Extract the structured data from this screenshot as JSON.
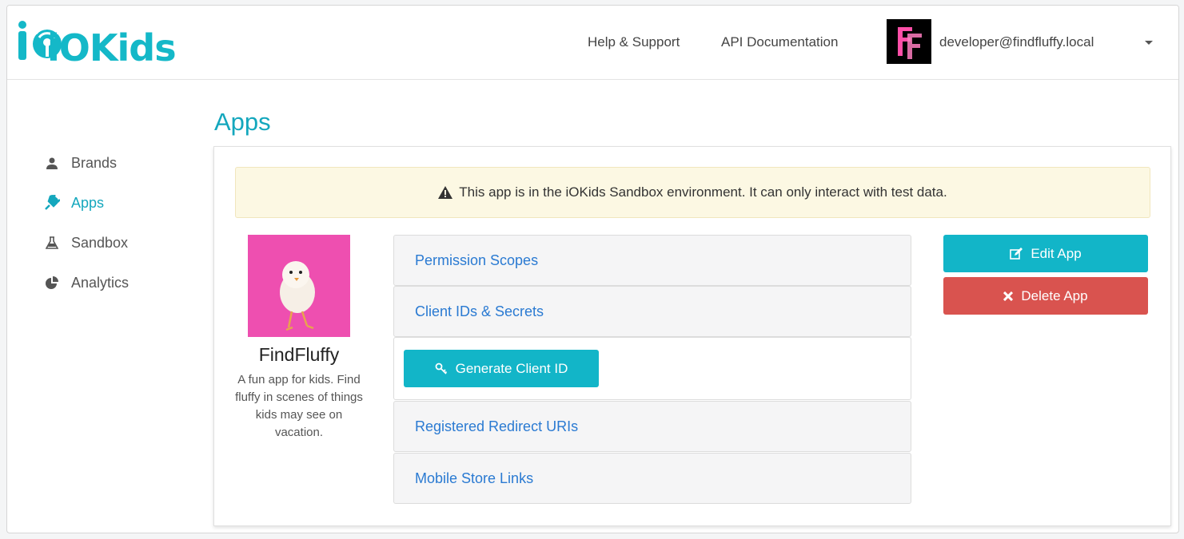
{
  "header": {
    "logo_text": "iOKids",
    "nav": [
      "Help & Support",
      "API Documentation"
    ],
    "avatar_initials": "FF",
    "user_email": "developer@findfluffy.local"
  },
  "sidebar": {
    "items": [
      {
        "label": "Brands",
        "icon": "user-icon",
        "active": false
      },
      {
        "label": "Apps",
        "icon": "plug-icon",
        "active": true
      },
      {
        "label": "Sandbox",
        "icon": "flask-icon",
        "active": false
      },
      {
        "label": "Analytics",
        "icon": "pie-chart-icon",
        "active": false
      }
    ]
  },
  "main": {
    "title": "Apps",
    "alert": "This app is in the iOKids Sandbox environment. It can only interact with test data.",
    "app": {
      "name": "FindFluffy",
      "description": "A fun app for kids. Find fluffy in scenes of things kids may see on vacation."
    },
    "panels": {
      "permission_scopes": "Permission Scopes",
      "client_ids": "Client IDs & Secrets",
      "generate_client_id": "Generate Client ID",
      "redirect_uris": "Registered Redirect URIs",
      "mobile_store_links": "Mobile Store Links"
    },
    "actions": {
      "edit": "Edit App",
      "delete": "Delete App"
    }
  },
  "colors": {
    "accent": "#14a7bd",
    "danger": "#d9534f",
    "alert_bg": "#fcf8e3",
    "link": "#2a7ad2"
  }
}
